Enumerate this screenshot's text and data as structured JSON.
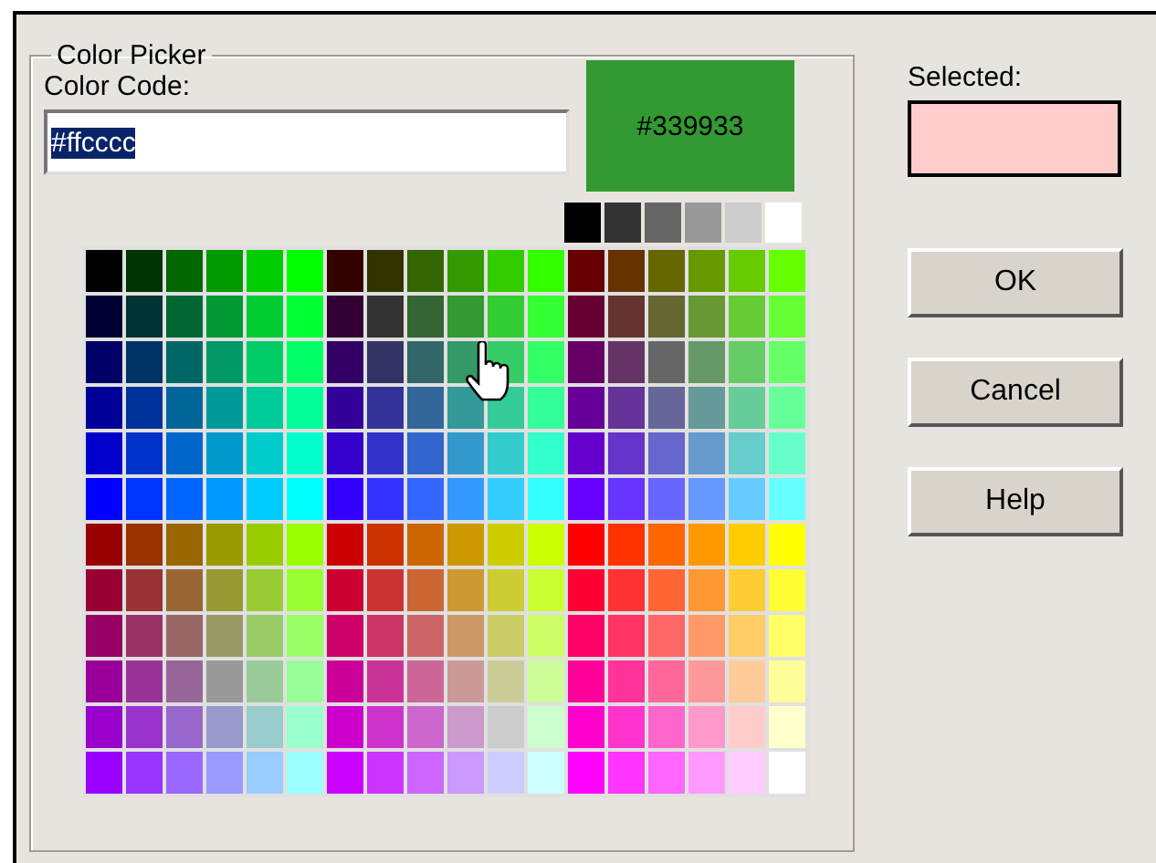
{
  "group": {
    "title": "Color Picker"
  },
  "color_code": {
    "label": "Color Code:",
    "value": "#ffcccc",
    "selected": true
  },
  "preview": {
    "text": "#339933",
    "color": "#339933"
  },
  "selected_swatch": {
    "label": "Selected:",
    "color": "#ffcccc"
  },
  "buttons": [
    "OK",
    "Cancel",
    "Help"
  ]
}
